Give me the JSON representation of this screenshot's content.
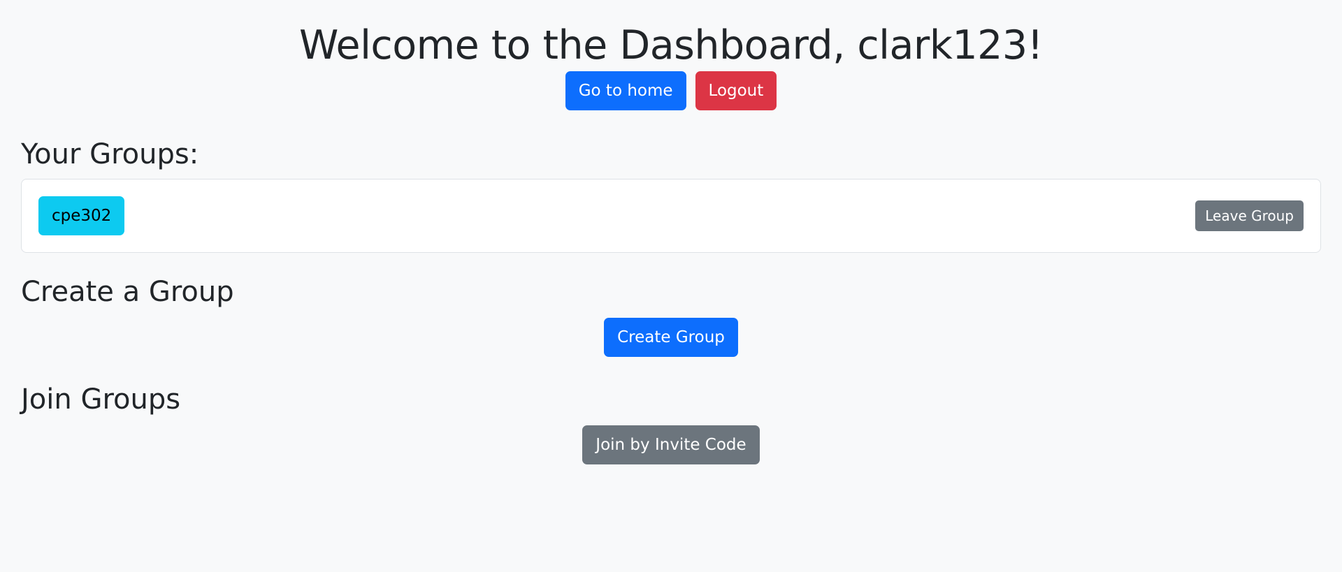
{
  "header": {
    "title": "Welcome to the Dashboard, clark123!",
    "home_label": "Go to home",
    "logout_label": "Logout"
  },
  "groups": {
    "heading": "Your Groups:",
    "items": [
      {
        "name": "cpe302",
        "leave_label": "Leave Group"
      }
    ]
  },
  "create": {
    "heading": "Create a Group",
    "button_label": "Create Group"
  },
  "join": {
    "heading": "Join Groups",
    "button_label": "Join by Invite Code"
  },
  "colors": {
    "primary": "#0d6efd",
    "danger": "#dc3545",
    "secondary": "#6c757d",
    "info": "#0dcaf0",
    "background": "#f8f9fa"
  }
}
